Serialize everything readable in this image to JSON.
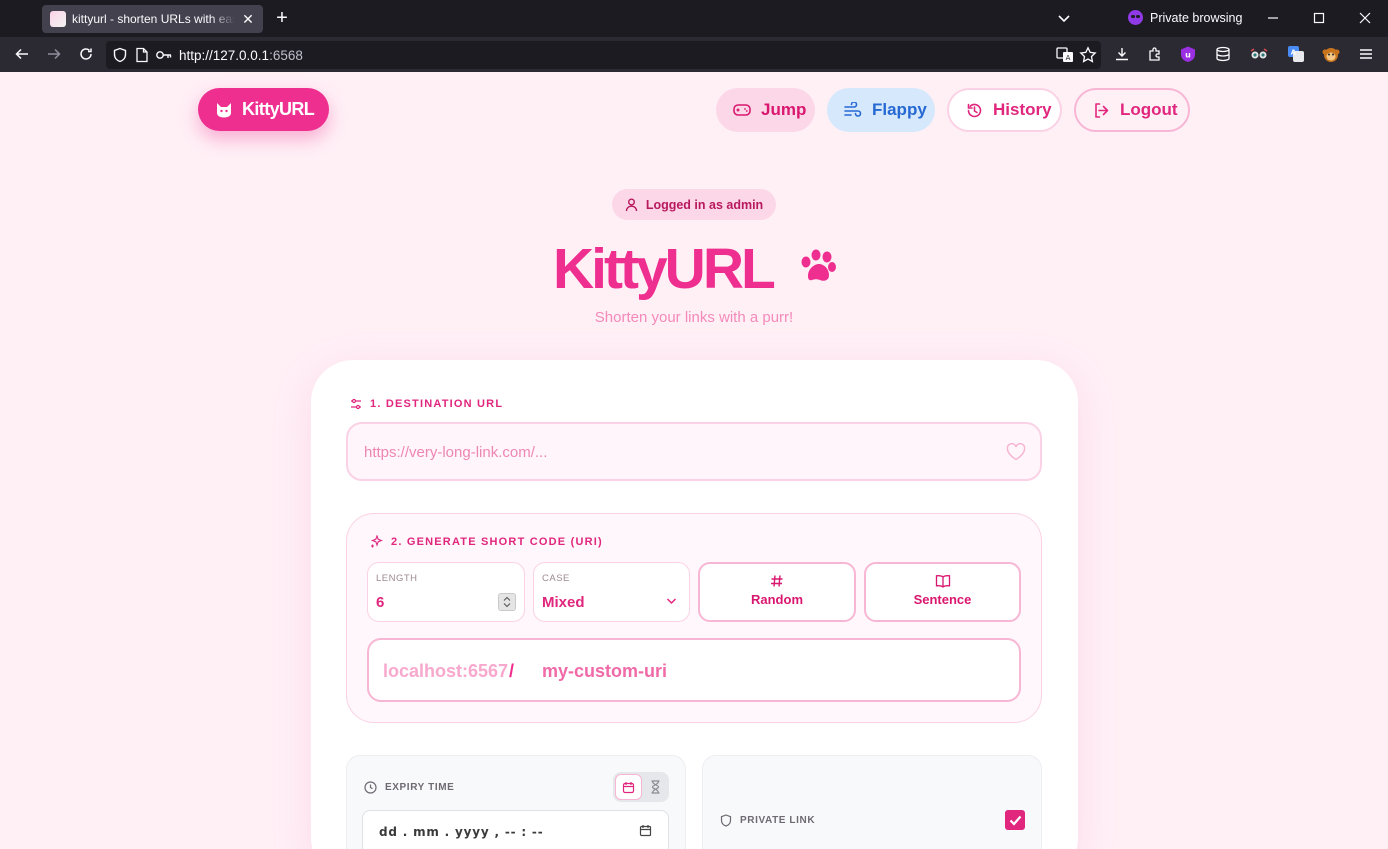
{
  "browser": {
    "tab_title": "kittyurl - shorten URLs with ease",
    "tab_close": "✕",
    "new_tab": "+",
    "private_label": "Private browsing",
    "url_host": "http://127.0.0.1",
    "url_port": ":6568"
  },
  "header": {
    "logo_text": "KittyURL",
    "nav": [
      {
        "label": "Jump",
        "icon": "gamepad-icon"
      },
      {
        "label": "Flappy",
        "icon": "wind-icon"
      },
      {
        "label": "History",
        "icon": "history-icon"
      },
      {
        "label": "Logout",
        "icon": "logout-icon"
      }
    ]
  },
  "status": {
    "logged_in": "Logged in as admin"
  },
  "hero": {
    "title": "KittyURL",
    "subtitle": "Shorten your links with a purr!"
  },
  "form": {
    "destination": {
      "label": "1. DESTINATION URL",
      "placeholder": "https://very-long-link.com/..."
    },
    "generate": {
      "label": "2. GENERATE SHORT CODE (URI)",
      "length_label": "LENGTH",
      "length_value": "6",
      "case_label": "CASE",
      "case_value": "Mixed",
      "random_label": "Random",
      "sentence_label": "Sentence",
      "host": "localhost:6567",
      "slash": "/",
      "custom_placeholder": "my-custom-uri"
    },
    "expiry": {
      "label": "EXPIRY TIME",
      "date_placeholder": "dd . mm . yyyy ,  -- : --"
    },
    "private": {
      "label": "PRIVATE LINK",
      "checked": true
    }
  },
  "colors": {
    "brand": "#ee2f90",
    "background": "#fff0f6",
    "flappy": "#2669d3"
  }
}
